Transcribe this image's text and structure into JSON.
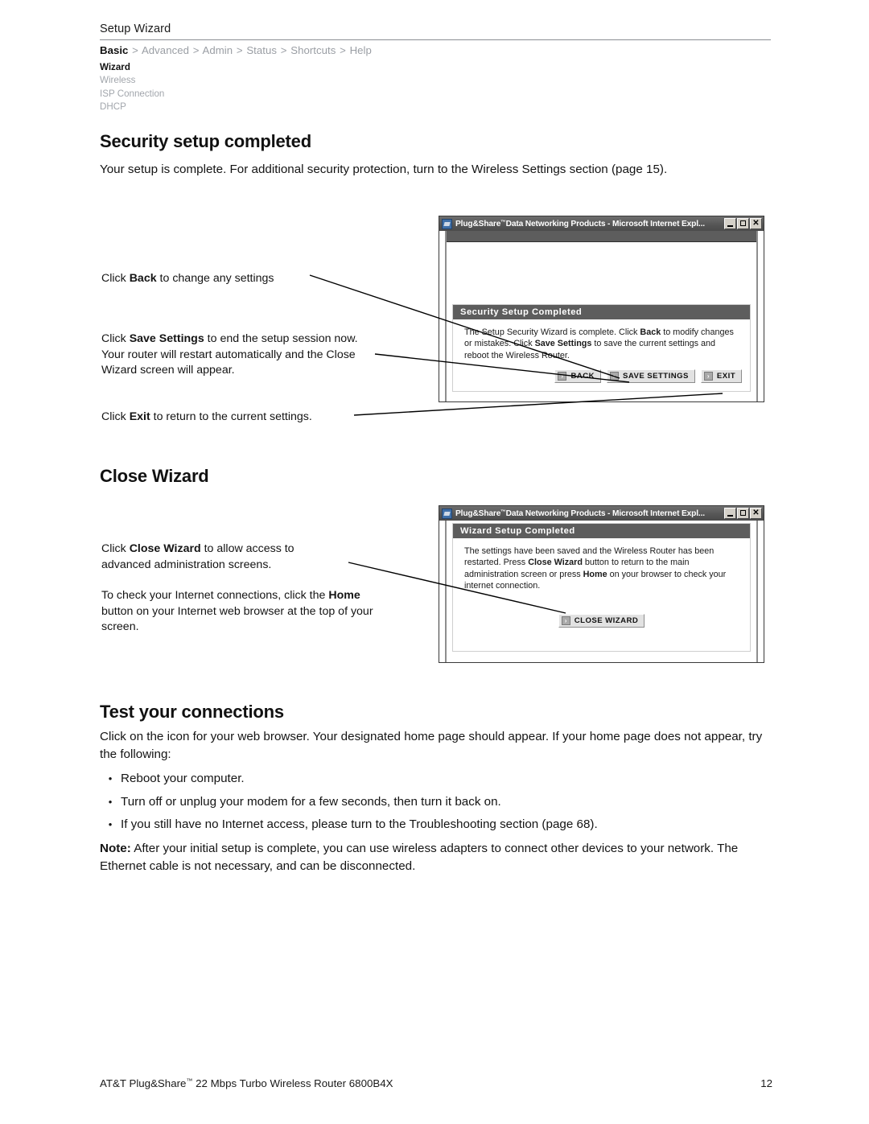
{
  "page": {
    "header_title": "Setup Wizard",
    "footer_left_prefix": "AT&T Plug&Share",
    "footer_left_tm": "™",
    "footer_left_suffix": " 22 Mbps Turbo Wireless Router 6800B4X",
    "footer_page_number": "12"
  },
  "breadcrumb": {
    "items": [
      "Basic",
      "Advanced",
      "Admin",
      "Status",
      "Shortcuts",
      "Help"
    ],
    "separator": ">",
    "active_index": 0
  },
  "subnav": {
    "items": [
      {
        "label": "Wizard",
        "active": true
      },
      {
        "label": "Wireless",
        "active": false
      },
      {
        "label": "ISP Connection",
        "active": false
      },
      {
        "label": "DHCP",
        "active": false
      }
    ]
  },
  "sections": {
    "security": {
      "heading": "Security setup completed",
      "intro": "Your setup is complete. For additional security protection, turn to the Wireless Settings section (page 15).",
      "callouts": {
        "back": {
          "pre": "Click ",
          "bold": "Back",
          "post": " to change any settings"
        },
        "save": {
          "pre": "Click ",
          "bold": "Save Settings",
          "post": " to end the setup session now. Your router will restart automatically and the Close Wizard screen will appear."
        },
        "exit": {
          "pre": "Click ",
          "bold": "Exit",
          "post": " to return to the current settings."
        }
      }
    },
    "close_wizard": {
      "heading": "Close Wizard",
      "callouts": {
        "close": {
          "pre": "Click ",
          "bold": "Close Wizard",
          "post": " to allow access to advanced administration screens."
        },
        "home": {
          "pre": "To check your Internet connections, click the ",
          "bold": "Home",
          "post": " button on your Internet web browser at the top of your screen."
        }
      }
    },
    "test": {
      "heading": "Test your connections",
      "intro": "Click on the icon for your web browser. Your designated home page should appear. If your home page does not appear, try the following:",
      "bullets": [
        "Reboot your computer.",
        "Turn off or unplug your modem for a few seconds, then turn it back on.",
        "If you still have no Internet access, please turn to the Troubleshooting section (page 68)."
      ],
      "bullet_marker": "•",
      "note": {
        "label": "Note:",
        "text": " After your initial setup is complete, you can use wireless adapters to connect other devices to your network. The Ethernet cable is not necessary, and can be disconnected."
      }
    }
  },
  "browser_window_1": {
    "title_prefix": "Plug&Share",
    "title_tm": "™",
    "title_suffix": "Data Networking Products - Microsoft Internet Expl...",
    "window_controls": {
      "minimize": "_",
      "maximize": "□",
      "close": "✕"
    },
    "panel_heading": "Security Setup Completed",
    "panel_text_1": "The Setup Security Wizard is complete. Click ",
    "panel_bold_1": "Back",
    "panel_text_2": " to modify changes or mistakes. Click ",
    "panel_bold_2": "Save Settings",
    "panel_text_3": " to save the current settings and reboot the Wireless Router.",
    "buttons": [
      {
        "label": "BACK",
        "glyph": "›"
      },
      {
        "label": "SAVE SETTINGS",
        "glyph": "›"
      },
      {
        "label": "EXIT",
        "glyph": "›"
      }
    ]
  },
  "browser_window_2": {
    "title_prefix": "Plug&Share",
    "title_tm": "™",
    "title_suffix": "Data Networking Products - Microsoft Internet Expl...",
    "window_controls": {
      "minimize": "_",
      "maximize": "□",
      "close": "✕"
    },
    "panel_heading": "Wizard Setup Completed",
    "panel_text_1": "The settings have been saved and the Wireless Router has been restarted. Press ",
    "panel_bold_1": "Close Wizard",
    "panel_text_2": " button to return to the main administration screen or press ",
    "panel_bold_2": "Home",
    "panel_text_3": " on your browser to check your internet connection.",
    "buttons": [
      {
        "label": "CLOSE WIZARD",
        "glyph": "›"
      }
    ]
  },
  "colors": {
    "titlebar": "#555555",
    "panel_head": "#5d5d5d",
    "muted_text": "#a2a6ac",
    "rule": "#8a8d93"
  }
}
